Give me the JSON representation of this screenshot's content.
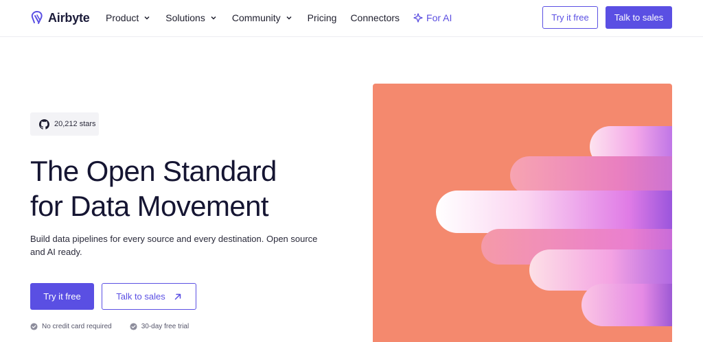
{
  "brand": {
    "name": "Airbyte",
    "accent": "#5a4fe3",
    "hero_bg": "#f4896e"
  },
  "nav": {
    "items": [
      {
        "label": "Product",
        "has_dropdown": true
      },
      {
        "label": "Solutions",
        "has_dropdown": true
      },
      {
        "label": "Community",
        "has_dropdown": true
      },
      {
        "label": "Pricing",
        "has_dropdown": false
      },
      {
        "label": "Connectors",
        "has_dropdown": false
      },
      {
        "label": "For AI",
        "icon": "sparkle-icon"
      }
    ],
    "try_free": "Try it free",
    "talk_sales": "Talk to sales"
  },
  "hero": {
    "stars_badge": {
      "icon": "github-icon",
      "text": "20,212 stars"
    },
    "headline": [
      "The Open Standard",
      "for Data Movement"
    ],
    "subtext": "Build data pipelines for every source and every destination. Open source and AI ready.",
    "cta_primary": "Try it free",
    "cta_secondary": "Talk to sales",
    "checks": [
      "No credit card required",
      "30-day free trial"
    ]
  }
}
